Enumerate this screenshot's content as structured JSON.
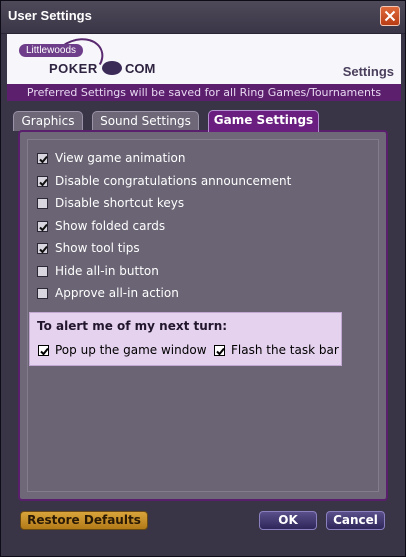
{
  "window": {
    "title": "User Settings"
  },
  "header": {
    "logo_top": "Littlewoods",
    "logo_word": "POKER",
    "logo_suffix": "COM",
    "heading": "Settings"
  },
  "banner": "Preferred Settings will be saved for all Ring Games/Tournaments",
  "tabs": [
    {
      "label": "Graphics",
      "active": false
    },
    {
      "label": "Sound Settings",
      "active": false
    },
    {
      "label": "Game Settings",
      "active": true
    }
  ],
  "options": [
    {
      "label": "View game animation",
      "checked": true
    },
    {
      "label": "Disable congratulations announcement",
      "checked": true
    },
    {
      "label": "Disable shortcut keys",
      "checked": false
    },
    {
      "label": "Show folded cards",
      "checked": true
    },
    {
      "label": "Show tool tips",
      "checked": true
    },
    {
      "label": "Hide all-in button",
      "checked": false
    },
    {
      "label": "Approve all-in action",
      "checked": false
    }
  ],
  "alert": {
    "title": "To alert me of my next turn:",
    "options": [
      {
        "label": "Pop up the game window",
        "checked": true
      },
      {
        "label": "Flash the task bar",
        "checked": true
      }
    ]
  },
  "buttons": {
    "restore": "Restore Defaults",
    "ok": "OK",
    "cancel": "Cancel"
  },
  "colors": {
    "accent_purple": "#5b1f6e",
    "active_tab": "#6a1f80",
    "restore_button": "#c8901f",
    "close_button": "#d0532a"
  }
}
